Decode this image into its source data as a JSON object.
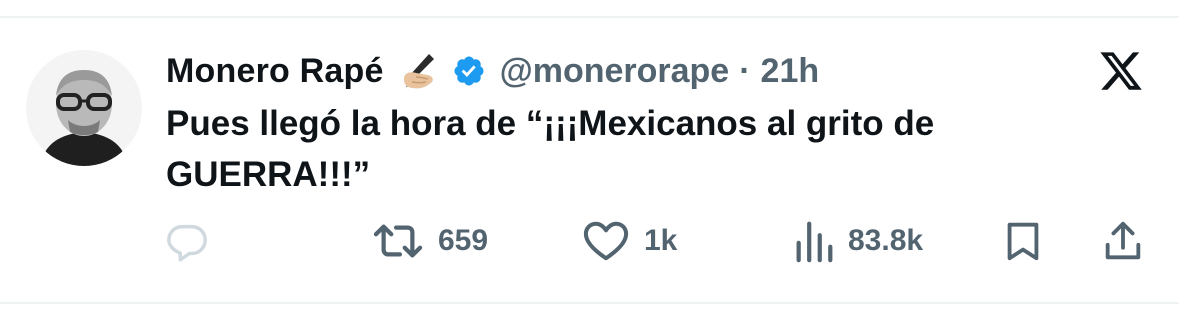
{
  "author": {
    "display_name": "Monero Rapé",
    "handle": "@monerorape",
    "separator": "·",
    "time": "21h"
  },
  "tweet": {
    "line1": "Pues llegó la hora de “¡¡¡Mexicanos al grito de",
    "line2": "GUERRA!!!”"
  },
  "actions": {
    "reply_count": "",
    "retweet_count": "659",
    "like_count": "1k",
    "views_count": "83.8k"
  },
  "icons": {
    "brand": "x-logo-icon",
    "verified": "verified-badge-icon",
    "writing_hand": "writing-hand-emoji-icon",
    "reply": "reply-icon",
    "retweet": "retweet-icon",
    "like": "heart-icon",
    "views": "views-icon",
    "bookmark": "bookmark-icon",
    "share": "share-icon"
  },
  "colors": {
    "text_primary": "#0f1419",
    "text_secondary": "#536471",
    "verified_blue": "#1d9bf0",
    "reply_icon_muted": "#cfd9de",
    "divider": "#eff3f4"
  }
}
